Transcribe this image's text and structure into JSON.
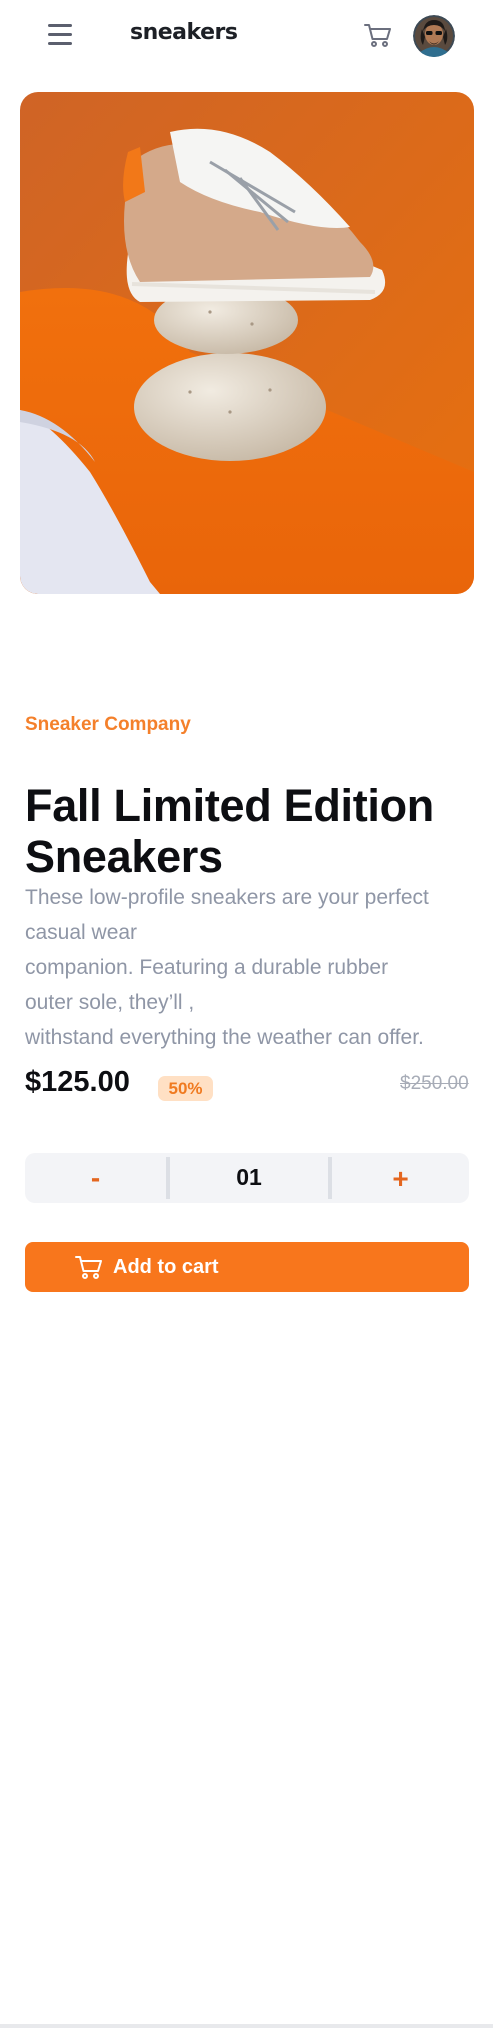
{
  "header": {
    "logo": "sneakers",
    "menu_icon": "hamburger-menu-icon",
    "cart_icon": "cart-icon",
    "avatar_icon": "user-avatar"
  },
  "product": {
    "image_icon": "product-photo-sneaker-on-stones",
    "company": "Sneaker Company",
    "title_lines": [
      "Fall Limited Edition",
      "Sneakers"
    ],
    "description_lines": [
      "These low-profile sneakers are your perfect",
      "casual wear",
      "companion. Featuring a durable rubber",
      "outer sole, they’ll ,",
      "withstand everything the weather can offer."
    ],
    "price": "$125.00",
    "discount": "50%",
    "original_price": "$250.00"
  },
  "quantity": {
    "minus": "-",
    "value": "01",
    "plus": "+"
  },
  "add_to_cart": {
    "label": "Add to cart",
    "icon": "cart-icon"
  },
  "colors": {
    "accent": "#f8761c",
    "company_text": "#f4802b",
    "discount_bg": "#ffe0c4",
    "muted_text": "#8f96a6",
    "dark_text": "#0d0e12"
  }
}
